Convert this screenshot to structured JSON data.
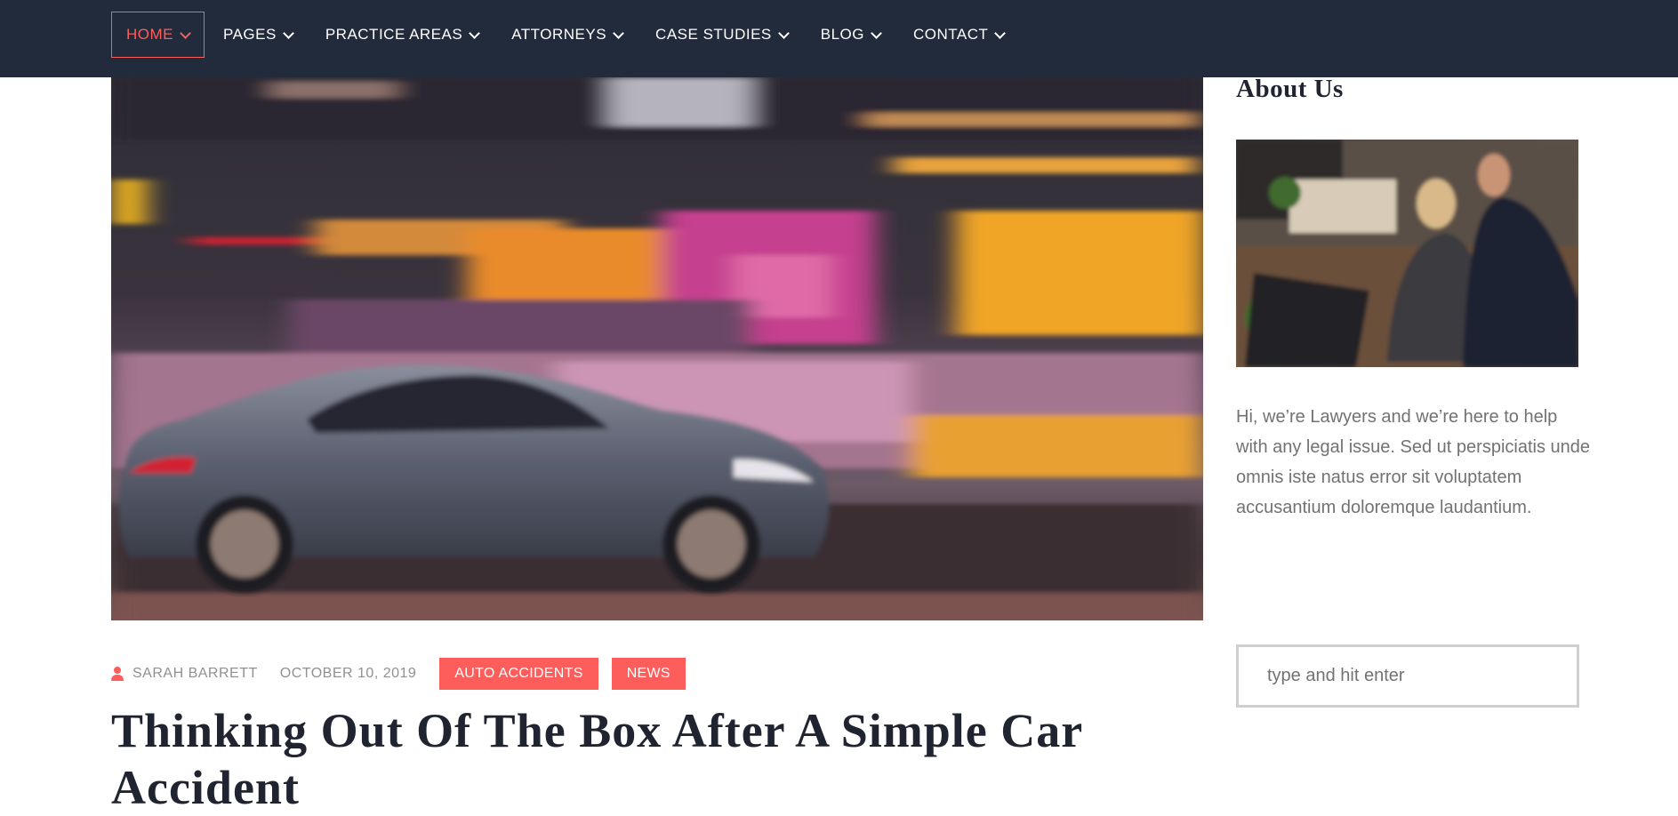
{
  "nav": {
    "items": [
      {
        "label": "HOME",
        "active": true
      },
      {
        "label": "PAGES",
        "active": false
      },
      {
        "label": "PRACTICE AREAS",
        "active": false
      },
      {
        "label": "ATTORNEYS",
        "active": false
      },
      {
        "label": "CASE STUDIES",
        "active": false
      },
      {
        "label": "BLOG",
        "active": false
      },
      {
        "label": "CONTACT",
        "active": false
      }
    ]
  },
  "post": {
    "author": "SARAH BARRETT",
    "date": "OCTOBER 10, 2019",
    "tags": [
      "AUTO ACCIDENTS",
      "NEWS"
    ],
    "title": "Thinking Out Of The Box After A Simple Car Accident"
  },
  "sidebar": {
    "about_title": "About Us",
    "about_text": "Hi, we’re Lawyers and we’re here to help with any legal issue. Sed ut perspiciatis unde omnis iste natus error sit voluptatem accusantium doloremque laudantium.",
    "search_placeholder": "type and hit enter"
  },
  "colors": {
    "nav_bg": "#212b3b",
    "accent": "#fd5d5b",
    "heading": "#1f2430",
    "body_text": "#727272"
  },
  "icons": {
    "author": "user-icon",
    "dropdown": "chevron-down-icon"
  }
}
